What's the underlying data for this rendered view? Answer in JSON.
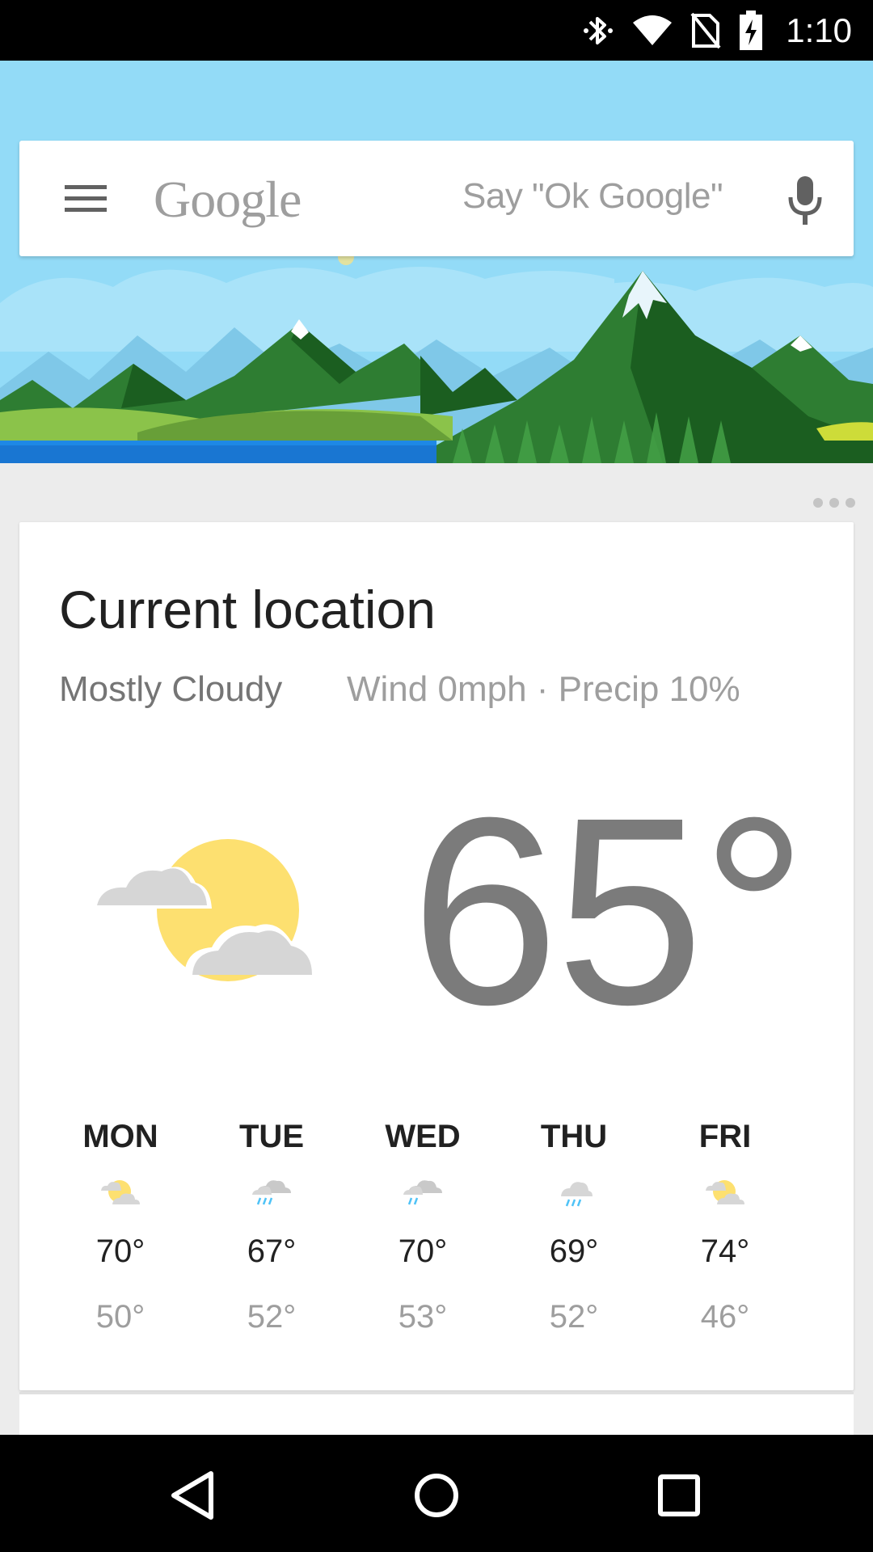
{
  "status_bar": {
    "time": "1:10",
    "icons": [
      "bluetooth-icon",
      "wifi-icon",
      "no-sim-icon",
      "battery-charging-icon"
    ]
  },
  "search": {
    "logo": "Google",
    "hint": "Say \"Ok Google\"",
    "menu_icon": "menu-icon",
    "mic_icon": "mic-icon"
  },
  "weather": {
    "location": "Current location",
    "condition": "Mostly Cloudy",
    "wind_precip": "Wind 0mph · Precip 10%",
    "current_temp": "65°",
    "current_icon": "partly-cloudy-icon",
    "forecast": [
      {
        "day": "MON",
        "high": "70°",
        "low": "50°",
        "icon": "partly-cloudy-icon"
      },
      {
        "day": "TUE",
        "high": "67°",
        "low": "52°",
        "icon": "rain-icon"
      },
      {
        "day": "WED",
        "high": "70°",
        "low": "53°",
        "icon": "rain-icon"
      },
      {
        "day": "THU",
        "high": "69°",
        "low": "52°",
        "icon": "rain-icon"
      },
      {
        "day": "FRI",
        "high": "74°",
        "low": "46°",
        "icon": "partly-cloudy-icon"
      }
    ]
  },
  "colors": {
    "sky": "#93dbf7",
    "sun": "#fde070",
    "cloud": "#d6d6d6",
    "rain": "#4fc3f7",
    "mountain_dark": "#1b5e20",
    "mountain_mid": "#2e7d32",
    "grass": "#8bc34a",
    "water": "#1e88e5"
  },
  "nav_bar": [
    "back-icon",
    "home-icon",
    "recents-icon"
  ]
}
